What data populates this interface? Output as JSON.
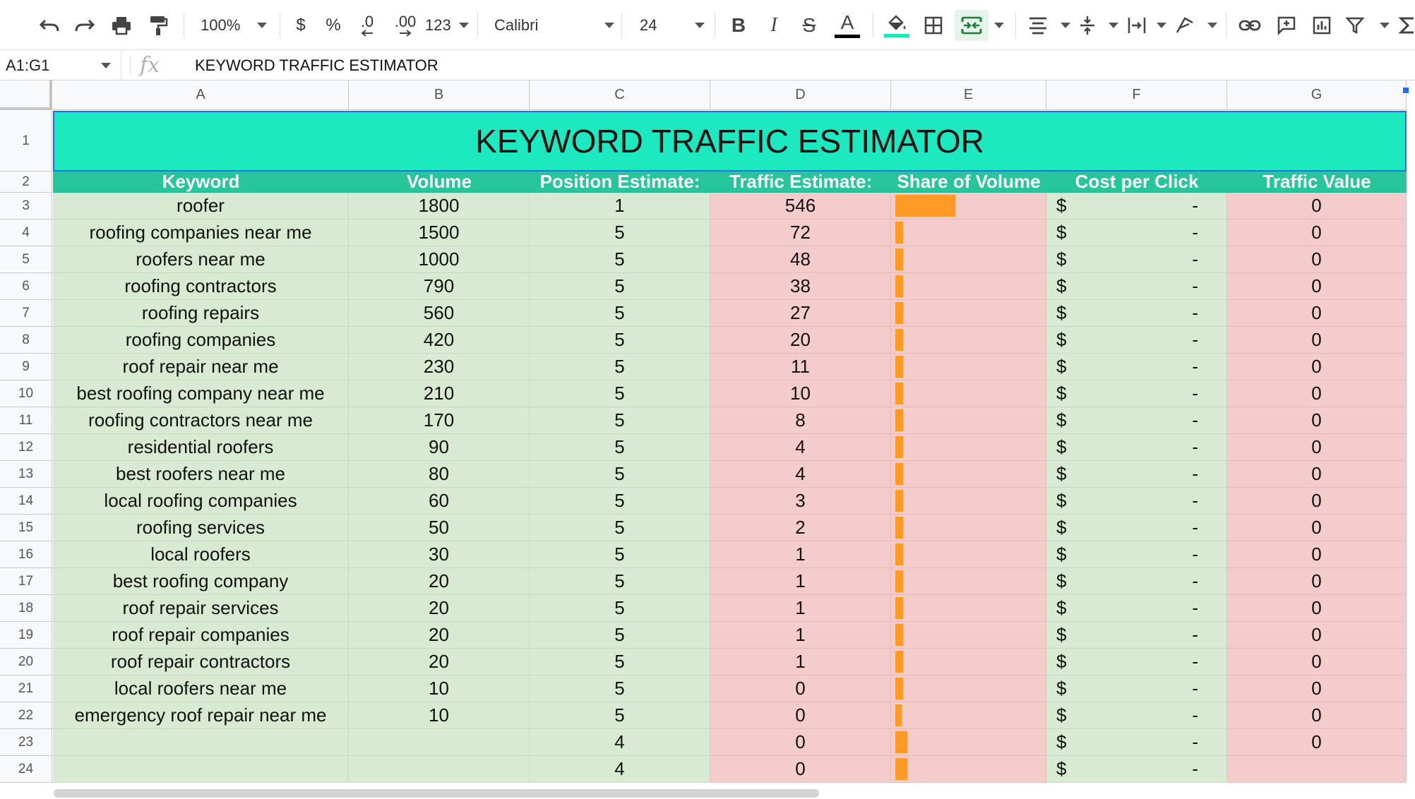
{
  "toolbar": {
    "zoom": "100%",
    "currency": "$",
    "percent": "%",
    "decrease_decimal": ".0",
    "increase_decimal": ".00",
    "more_formats": "123",
    "font": "Calibri",
    "font_size": "24",
    "bold": "B",
    "italic": "I",
    "strikethrough": "S",
    "text_color_letter": "A",
    "fill_color": "#1de9b6"
  },
  "formula_bar": {
    "name_box": "A1:G1",
    "fx": "fx",
    "content": "KEYWORD TRAFFIC ESTIMATOR"
  },
  "columns": [
    "A",
    "B",
    "C",
    "D",
    "E",
    "F",
    "G"
  ],
  "rows": [
    "1",
    "2",
    "3",
    "4",
    "5",
    "6",
    "7",
    "8",
    "9",
    "10",
    "11",
    "12",
    "13",
    "14",
    "15",
    "16",
    "17",
    "18",
    "19",
    "20",
    "21",
    "22",
    "23",
    "24"
  ],
  "sheet": {
    "title": "KEYWORD TRAFFIC ESTIMATOR",
    "headers": [
      "Keyword",
      "Volume",
      "Position Estimate:",
      "Traffic Estimate:",
      "Share of Volume",
      "Cost per Click",
      "Traffic Value"
    ],
    "rows": [
      {
        "keyword": "roofer",
        "volume": "1800",
        "position": "1",
        "traffic": "546",
        "share": 0.09,
        "cpc_symbol": "$",
        "cpc": "-",
        "value": "0"
      },
      {
        "keyword": "roofing companies near me",
        "volume": "1500",
        "position": "5",
        "traffic": "72",
        "share": 0.012,
        "cpc_symbol": "$",
        "cpc": "-",
        "value": "0"
      },
      {
        "keyword": "roofers near me",
        "volume": "1000",
        "position": "5",
        "traffic": "48",
        "share": 0.012,
        "cpc_symbol": "$",
        "cpc": "-",
        "value": "0"
      },
      {
        "keyword": "roofing contractors",
        "volume": "790",
        "position": "5",
        "traffic": "38",
        "share": 0.012,
        "cpc_symbol": "$",
        "cpc": "-",
        "value": "0"
      },
      {
        "keyword": "roofing repairs",
        "volume": "560",
        "position": "5",
        "traffic": "27",
        "share": 0.012,
        "cpc_symbol": "$",
        "cpc": "-",
        "value": "0"
      },
      {
        "keyword": "roofing companies",
        "volume": "420",
        "position": "5",
        "traffic": "20",
        "share": 0.012,
        "cpc_symbol": "$",
        "cpc": "-",
        "value": "0"
      },
      {
        "keyword": "roof repair near me",
        "volume": "230",
        "position": "5",
        "traffic": "11",
        "share": 0.012,
        "cpc_symbol": "$",
        "cpc": "-",
        "value": "0"
      },
      {
        "keyword": "best roofing company near me",
        "volume": "210",
        "position": "5",
        "traffic": "10",
        "share": 0.012,
        "cpc_symbol": "$",
        "cpc": "-",
        "value": "0"
      },
      {
        "keyword": "roofing contractors near me",
        "volume": "170",
        "position": "5",
        "traffic": "8",
        "share": 0.012,
        "cpc_symbol": "$",
        "cpc": "-",
        "value": "0"
      },
      {
        "keyword": "residential roofers",
        "volume": "90",
        "position": "5",
        "traffic": "4",
        "share": 0.012,
        "cpc_symbol": "$",
        "cpc": "-",
        "value": "0"
      },
      {
        "keyword": "best roofers near me",
        "volume": "80",
        "position": "5",
        "traffic": "4",
        "share": 0.012,
        "cpc_symbol": "$",
        "cpc": "-",
        "value": "0"
      },
      {
        "keyword": "local roofing companies",
        "volume": "60",
        "position": "5",
        "traffic": "3",
        "share": 0.012,
        "cpc_symbol": "$",
        "cpc": "-",
        "value": "0"
      },
      {
        "keyword": "roofing services",
        "volume": "50",
        "position": "5",
        "traffic": "2",
        "share": 0.012,
        "cpc_symbol": "$",
        "cpc": "-",
        "value": "0"
      },
      {
        "keyword": "local roofers",
        "volume": "30",
        "position": "5",
        "traffic": "1",
        "share": 0.012,
        "cpc_symbol": "$",
        "cpc": "-",
        "value": "0"
      },
      {
        "keyword": "best roofing company",
        "volume": "20",
        "position": "5",
        "traffic": "1",
        "share": 0.012,
        "cpc_symbol": "$",
        "cpc": "-",
        "value": "0"
      },
      {
        "keyword": "roof repair services",
        "volume": "20",
        "position": "5",
        "traffic": "1",
        "share": 0.012,
        "cpc_symbol": "$",
        "cpc": "-",
        "value": "0"
      },
      {
        "keyword": "roof repair companies",
        "volume": "20",
        "position": "5",
        "traffic": "1",
        "share": 0.012,
        "cpc_symbol": "$",
        "cpc": "-",
        "value": "0"
      },
      {
        "keyword": "roof repair contractors",
        "volume": "20",
        "position": "5",
        "traffic": "1",
        "share": 0.012,
        "cpc_symbol": "$",
        "cpc": "-",
        "value": "0"
      },
      {
        "keyword": "local roofers near me",
        "volume": "10",
        "position": "5",
        "traffic": "0",
        "share": 0.012,
        "cpc_symbol": "$",
        "cpc": "-",
        "value": "0"
      },
      {
        "keyword": "emergency roof repair near me",
        "volume": "10",
        "position": "5",
        "traffic": "0",
        "share": 0.01,
        "cpc_symbol": "$",
        "cpc": "-",
        "value": "0"
      },
      {
        "keyword": "",
        "volume": "",
        "position": "4",
        "traffic": "0",
        "share": 0.018,
        "cpc_symbol": "$",
        "cpc": "-",
        "value": "0"
      },
      {
        "keyword": "",
        "volume": "",
        "position": "4",
        "traffic": "0",
        "share": 0.018,
        "cpc_symbol": "$",
        "cpc": "-",
        "value": ""
      }
    ]
  },
  "colors": {
    "title_fill": "#1de9c0",
    "header_fill": "#26c59a",
    "green_fill": "#d9ead3",
    "pink_fill": "#f4cccc",
    "bar_fill": "#ff9a26",
    "selection": "#1a73e8"
  }
}
